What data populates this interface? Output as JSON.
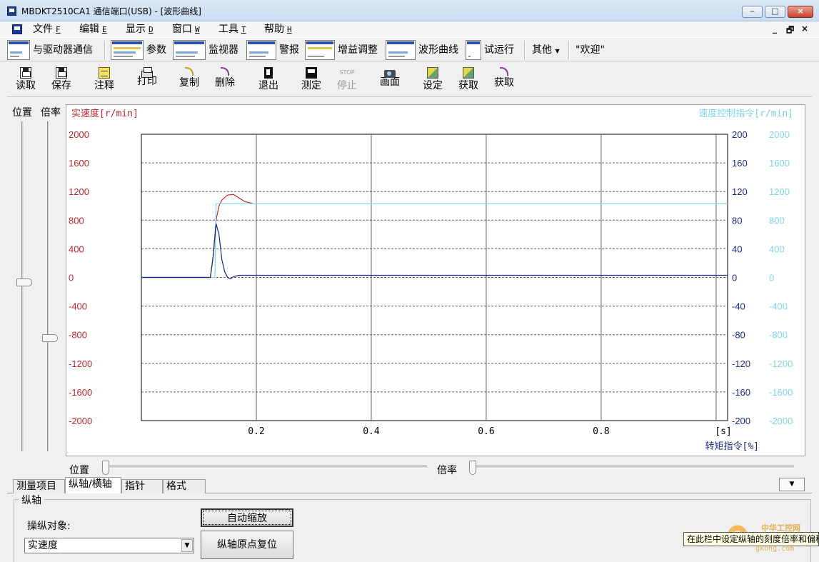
{
  "window": {
    "title": "MBDKT2510CA1  通信端口(USB)  - [波形曲线]",
    "minimize": "‒",
    "maximize": "□",
    "close": "×",
    "mdi_minimize": "_",
    "mdi_restore": "🗗",
    "mdi_close": "×"
  },
  "menu": [
    {
      "label": "文件",
      "accel": "F"
    },
    {
      "label": "编辑",
      "accel": "E"
    },
    {
      "label": "显示",
      "accel": "D"
    },
    {
      "label": "窗口",
      "accel": "W"
    },
    {
      "label": "工具",
      "accel": "T"
    },
    {
      "label": "帮助",
      "accel": "H"
    }
  ],
  "toolbar1": {
    "comm": "与驱动器通信",
    "params": "参数",
    "monitor": "监视器",
    "alarm": "警报",
    "gain": "增益调整",
    "waveform": "波形曲线",
    "trial": "试运行",
    "other": "其他",
    "welcome": "\"欢迎\""
  },
  "toolbar2": [
    {
      "label": "读取",
      "icon": "floppy-read-icon"
    },
    {
      "label": "保存",
      "icon": "floppy-save-icon"
    },
    {
      "label": "注释",
      "icon": "note-icon"
    },
    {
      "label": "打印",
      "icon": "printer-icon"
    },
    {
      "label": "复制",
      "icon": "copy-curve-icon"
    },
    {
      "label": "删除",
      "icon": "delete-curve-icon"
    },
    {
      "label": "退出",
      "icon": "exit-icon"
    },
    {
      "label": "测定",
      "icon": "measure-icon"
    },
    {
      "label": "停止",
      "icon": "stop-icon",
      "icon_text": "STOP",
      "disabled": true
    },
    {
      "label": "画面",
      "icon": "camera-icon"
    },
    {
      "label": "设定",
      "icon": "set-icon"
    },
    {
      "label": "获取",
      "icon": "get-icon"
    },
    {
      "label": "获取",
      "icon": "get-curve-icon"
    }
  ],
  "vsliders": {
    "position_label": "位置",
    "scale_label": "倍率",
    "position_level": 0.5,
    "scale_level": 0.33
  },
  "hsliders": {
    "position_label": "位置",
    "scale_label": "倍率"
  },
  "tabs": [
    "测量项目",
    "纵轴/横轴",
    "指针",
    "格式"
  ],
  "active_tab": "纵轴/横轴",
  "axis_panel": {
    "group_title": "纵轴",
    "target_label": "操纵对象:",
    "target_value": "实速度",
    "auto_zoom_button": "自动缩放",
    "reset_origin_button": "纵轴原点复位"
  },
  "tooltip": "在此栏中设定纵轴的刻度倍率和偏移",
  "watermark": {
    "line1": "中华工控网",
    "line2": "gkong.com"
  },
  "colors": {
    "speed": "#c0262c",
    "speed_cmd": "#7fd3ec",
    "torque": "#1a2a8a",
    "grid": "#606060"
  },
  "chart_data": {
    "type": "line",
    "title": "",
    "ylabel_left": "实速度[r/min]",
    "ylabel_right_outer": "速度控制指令[r/min]",
    "ylabel_right_inner": "转矩指令[%]",
    "xunit": "[s]",
    "xlim": [
      0,
      1.02
    ],
    "x_ticks": [
      "0.2",
      "0.4",
      "0.6",
      "0.8"
    ],
    "ylim_left": [
      -2000,
      2000
    ],
    "ylim_right_inner": [
      -200,
      200
    ],
    "ylim_right_outer": [
      -2000,
      2000
    ],
    "y_ticks_left": [
      "2000",
      "1600",
      "1200",
      "800",
      "400",
      "0",
      "-400",
      "-800",
      "-1200",
      "-1600",
      "-2000"
    ],
    "y_ticks_right_inner": [
      "200",
      "160",
      "120",
      "80",
      "40",
      "0",
      "-40",
      "-80",
      "-120",
      "-160",
      "-200"
    ],
    "y_ticks_right_outer": [
      "2000",
      "1600",
      "1200",
      "800",
      "400",
      "0",
      "-400",
      "-800",
      "-1200",
      "-1600",
      "-2000"
    ],
    "grid": true,
    "series": [
      {
        "name": "实速度",
        "axis": "left",
        "color": "#c0262c",
        "x": [
          0.0,
          0.12,
          0.125,
          0.13,
          0.135,
          0.14,
          0.15,
          0.16,
          0.17,
          0.18,
          0.19,
          0.195
        ],
        "y": [
          0,
          0,
          300,
          800,
          1000,
          1080,
          1150,
          1160,
          1110,
          1060,
          1040,
          1030
        ]
      },
      {
        "name": "速度控制指令",
        "axis": "right_outer",
        "color": "#7fd3ec",
        "x": [
          0.0,
          0.128,
          0.13,
          1.02
        ],
        "y": [
          0,
          0,
          1030,
          1030
        ]
      },
      {
        "name": "转矩指令",
        "axis": "right_inner",
        "color": "#1a2a8a",
        "x": [
          0.0,
          0.12,
          0.125,
          0.13,
          0.135,
          0.14,
          0.145,
          0.15,
          0.155,
          0.16,
          0.17,
          1.02
        ],
        "y": [
          0,
          0,
          30,
          75,
          60,
          25,
          8,
          0,
          -2,
          1,
          3,
          3
        ]
      }
    ]
  }
}
